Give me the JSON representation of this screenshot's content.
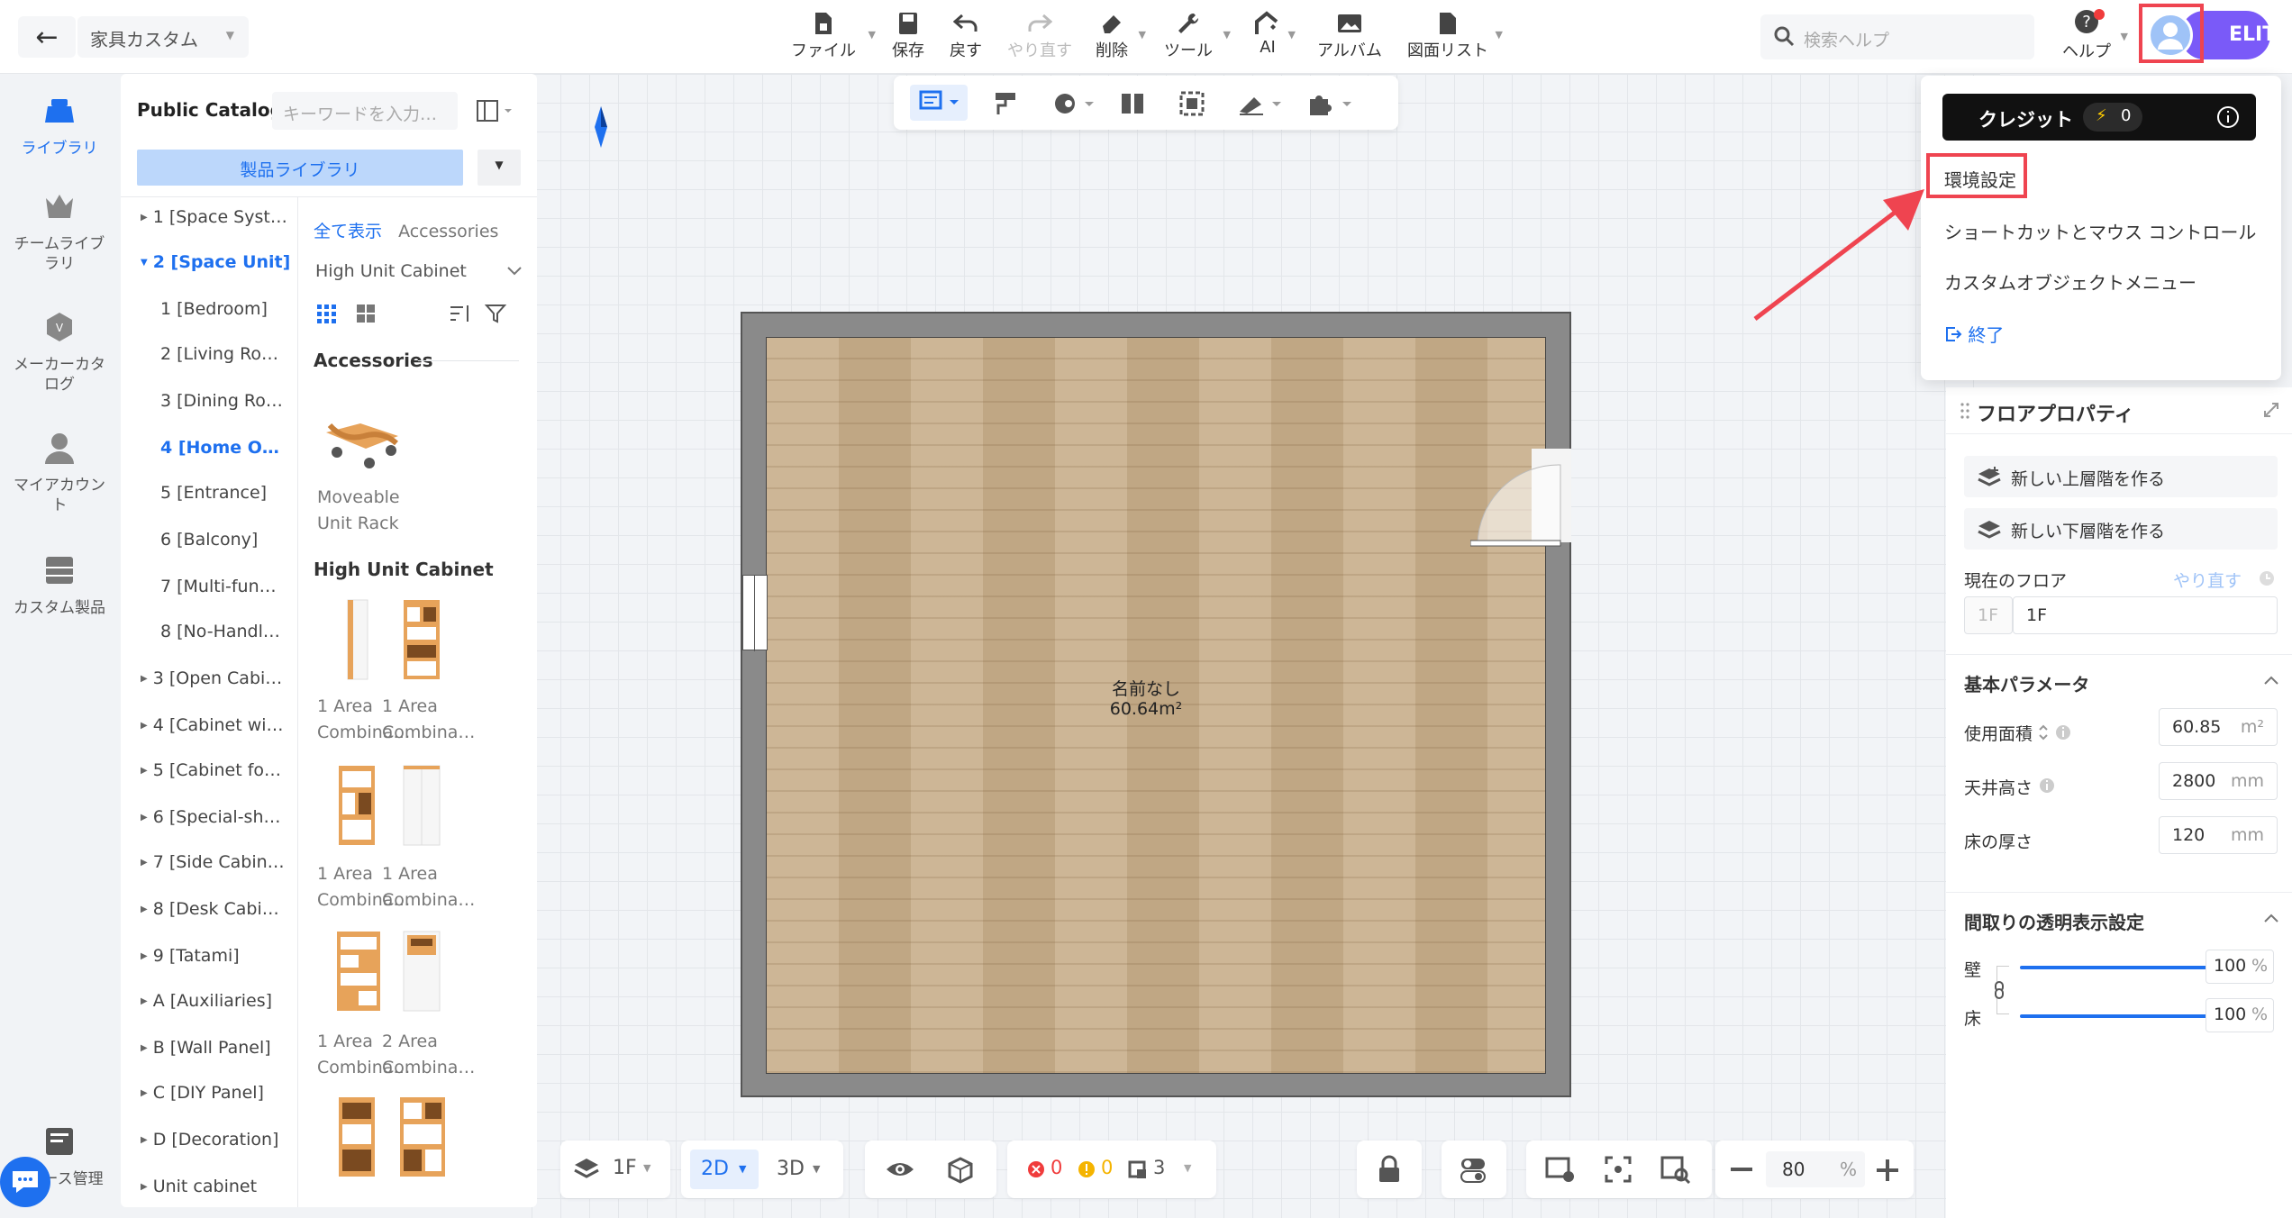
{
  "header": {
    "project_name": "家具カスタム",
    "tools": [
      {
        "label": "ファイル",
        "icon": "file-icon"
      },
      {
        "label": "保存",
        "icon": "save-icon"
      },
      {
        "label": "戻す",
        "icon": "undo-icon"
      },
      {
        "label": "やり直す",
        "icon": "redo-icon"
      },
      {
        "label": "削除",
        "icon": "eraser-icon"
      },
      {
        "label": "ツール",
        "icon": "wrench-icon"
      },
      {
        "label": "AI",
        "icon": "ai-icon"
      },
      {
        "label": "アルバム",
        "icon": "album-icon"
      },
      {
        "label": "図面リスト",
        "icon": "drawing-list-icon"
      }
    ],
    "search_placeholder": "検索ヘルプ",
    "help_label": "ヘルプ",
    "badge": "ELITE"
  },
  "rail": [
    {
      "label": "ライブラリ",
      "icon": "library-icon"
    },
    {
      "label": "チームライブラリ",
      "icon": "team-library-icon"
    },
    {
      "label": "メーカーカタログ",
      "icon": "maker-catalog-icon"
    },
    {
      "label": "マイアカウント",
      "icon": "account-icon"
    },
    {
      "label": "カスタム製品",
      "icon": "custom-product-icon"
    },
    {
      "label": "ース管理",
      "icon": "management-icon"
    }
  ],
  "library": {
    "title": "Public Catalog",
    "search_placeholder": "キーワードを入力…",
    "product_library": "製品ライブラリ",
    "tree": [
      "1 [Space Syst…",
      "2 [Space Unit]",
      "1 [Bedroom]",
      "2 [Living Ro…",
      "3 [Dining Ro…",
      "4 [Home O…",
      "5 [Entrance]",
      "6 [Balcony]",
      "7 [Multi-fun…",
      "8 [No-Handl…",
      "3 [Open Cabi…",
      "4 [Cabinet wi…",
      "5 [Cabinet fo…",
      "6 [Special-sh…",
      "7 [Side Cabin…",
      "8 [Desk Cabi…",
      "9 [Tatami]",
      "A [Auxiliaries]",
      "B [Wall Panel]",
      "C [DIY Panel]",
      "D [Decoration]",
      "Unit cabinet"
    ],
    "crumb_all": "全て表示",
    "crumb_current": "Accessories",
    "filter": "High Unit Cabinet",
    "section_accessories": "Accessories",
    "accessory_item": "Moveable Unit Rack",
    "section_high": "High Unit Cabinet",
    "products": [
      "1 Area Combina…",
      "1 Area Combina…",
      "1 Area Combina…",
      "1 Area Combina…",
      "1 Area Combina…",
      "2 Area Combina…"
    ]
  },
  "room": {
    "name": "名前なし",
    "area": "60.64m²"
  },
  "bottom": {
    "floor": "1F",
    "mode_2d": "2D",
    "mode_3d": "3D",
    "errors": "0",
    "warnings": "0",
    "items": "3",
    "zoom": "80",
    "zoom_unit": "%"
  },
  "menu": {
    "credit_label": "クレジット",
    "credit_value": "0",
    "items": [
      "環境設定",
      "ショートカットとマウス コントロール",
      "カスタムオブジェクトメニュー"
    ],
    "exit": "終了"
  },
  "props": {
    "title": "フロアプロパティ",
    "new_upper": "新しい上層階を作る",
    "new_lower": "新しい下層階を作る",
    "current_floor": "現在のフロア",
    "redo": "やり直す",
    "floor_code": "1F",
    "floor_name": "1F",
    "basic": "基本パラメータ",
    "area_label": "使用面積",
    "area_value": "60.85",
    "area_unit": "m²",
    "ceiling_label": "天井高さ",
    "ceiling_value": "2800",
    "thickness_label": "床の厚さ",
    "thickness_value": "120",
    "unit_mm": "mm",
    "transparency": "間取りの透明表示設定",
    "wall_label": "壁",
    "floor_label": "床",
    "wall_value": "100",
    "floor_value": "100",
    "percent": "%"
  },
  "colors": {
    "accent": "#1e70ef",
    "highlight": "#ef4450",
    "elite": "#7a5af8"
  }
}
